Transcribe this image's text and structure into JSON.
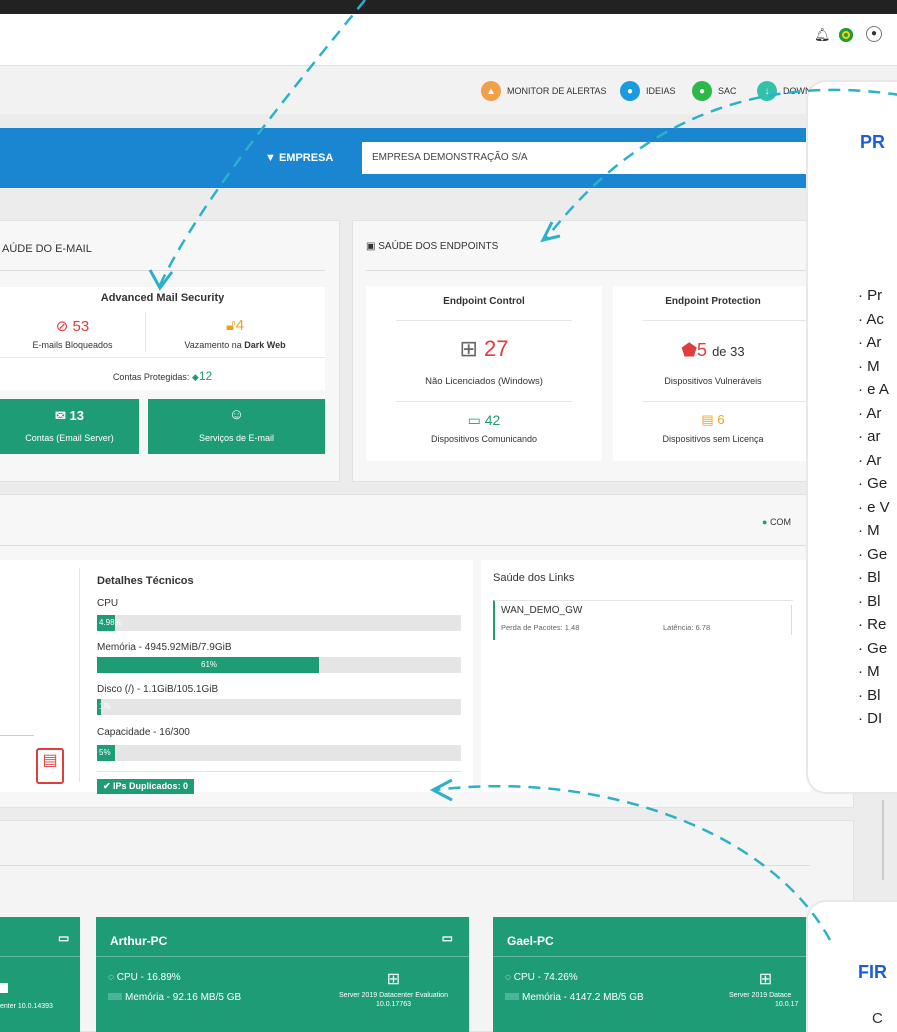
{
  "header": {
    "icons": [
      "bell-icon",
      "flag-icon",
      "user-icon"
    ]
  },
  "quick_links": [
    {
      "label": "MONITOR DE ALERTAS",
      "color": "#f0a04b"
    },
    {
      "label": "IDEIAS",
      "color": "#1a9be0"
    },
    {
      "label": "SAC",
      "color": "#2eb84a"
    },
    {
      "label": "DOWN",
      "color": "#33c1a8"
    }
  ],
  "filter": {
    "label": "EMPRESA",
    "value": "EMPRESA DEMONSTRAÇÃO S/A"
  },
  "email_health": {
    "title": "AÚDE DO E-MAIL",
    "card_title": "Advanced Mail Security",
    "blocked_value": "53",
    "blocked_label": "E-mails Bloqueados",
    "leak_value": "4",
    "leak_label_prefix": "Vazamento na",
    "leak_label_bold": "Dark Web",
    "protected_label": "Contas Protegidas:",
    "protected_value": "12",
    "accounts_value": "13",
    "accounts_label": "Contas (Email Server)",
    "services_label": "Serviços de E-mail"
  },
  "endpoints": {
    "title": "SAÚDE DOS ENDPOINTS",
    "control_title": "Endpoint Control",
    "unlicensed_value": "27",
    "unlicensed_label": "Não Licenciados (Windows)",
    "communicating_value": "42",
    "communicating_label": "Dispositivos Comunicando",
    "protection_title": "Endpoint Protection",
    "vulnerable_value": "5",
    "vulnerable_of": "de 33",
    "vulnerable_label": "Dispositivos Vulneráveis",
    "nolicense_value": "6",
    "nolicense_label": "Dispositivos sem Licença"
  },
  "status_badge": "COM",
  "tech": {
    "title": "Detalhes Técnicos",
    "cpu_label": "CPU",
    "cpu_pct": "4.98%",
    "cpu_fill": 0.05,
    "mem_label": "Memória - 4945.92MiB/7.9GiB",
    "mem_pct": "61%",
    "mem_fill": 0.61,
    "disk_label": "Disco (/) - 1.1GiB/105.1GiB",
    "disk_pct": "1%",
    "disk_fill": 0.01,
    "cap_label": "Capacidade - 16/300",
    "cap_pct": "5%",
    "cap_fill": 0.05,
    "dup_label": "IPs Duplicados: 0"
  },
  "links": {
    "title": "Saúde dos Links",
    "name": "WAN_DEMO_GW",
    "loss": "Perda de Pacotes: 1.48",
    "latency": "Latência: 6.78"
  },
  "overlay_top": {
    "title": "PR",
    "items": [
      "Pr",
      "Ac",
      "Ar",
      "M",
      "e A",
      "Ar",
      "ar",
      "Ar",
      "Ge",
      "e V",
      "M",
      "Ge",
      "Bl",
      "Bl",
      "Re",
      "Ge",
      "M",
      "Bl",
      "DI"
    ]
  },
  "overlay_bottom": {
    "title": "FIR",
    "text": "C"
  },
  "devices": [
    {
      "name": "",
      "os": "enter 10.0.14393"
    },
    {
      "name": "Arthur-PC",
      "cpu": "CPU - 16.89%",
      "mem": "Memória - 92.16 MB/5 GB",
      "os": "Server 2019 Datacenter Evaluation",
      "build": "10.0.17763"
    },
    {
      "name": "Gael-PC",
      "cpu": "CPU - 74.26%",
      "mem": "Memória - 4147.2 MB/5 GB",
      "os": "Server 2019 Datace",
      "build": "10.0.17"
    }
  ]
}
